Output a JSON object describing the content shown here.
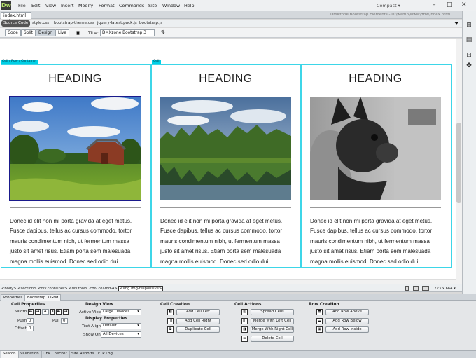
{
  "app": {
    "logo": "Dw",
    "menu": [
      "File",
      "Edit",
      "View",
      "Insert",
      "Modify",
      "Format",
      "Commands",
      "Site",
      "Window",
      "Help"
    ],
    "workspace": "Compact ▾"
  },
  "document": {
    "tab": "index.html",
    "path": "DMXzone Bootstrap Elements - D:\\wamp\\www\\dmf\\index.html"
  },
  "related_files": [
    "Source Code",
    "style.css",
    "bootstrap-theme.css",
    "jquery-latest.pack.js",
    "bootstrap.js"
  ],
  "view_buttons": [
    "Code",
    "Split",
    "Design",
    "Live"
  ],
  "title_label": "Title:",
  "title_value": "DMXzone Bootstrap 3",
  "canvas": {
    "badges": [
      "Cell / Row / Container",
      "Cell"
    ],
    "columns": [
      {
        "heading": "HEADING",
        "text": "Donec id elit non mi porta gravida at eget metus. Fusce dapibus, tellus ac cursus commodo, tortor mauris condimentum nibh, ut fermentum massa justo sit amet risus. Etiam porta sem malesuada magna mollis euismod. Donec sed odio dui.",
        "image": "barn-meadow"
      },
      {
        "heading": "HEADING",
        "text": "Donec id elit non mi porta gravida at eget metus. Fusce dapibus, tellus ac cursus commodo, tortor mauris condimentum nibh, ut fermentum massa justo sit amet risus. Etiam porta sem malesuada magna mollis euismod. Donec sed odio dui.",
        "image": "lake-forest"
      },
      {
        "heading": "HEADING",
        "text": "Donec id elit non mi porta gravida at eget metus. Fusce dapibus, tellus ac cursus commodo, tortor mauris condimentum nibh, ut fermentum massa justo sit amet risus. Etiam porta sem malesuada magna mollis euismod. Donec sed odio dui.",
        "image": "french-bulldog"
      }
    ]
  },
  "status": {
    "tags": [
      "<body>",
      "<section>",
      "<div.container>",
      "<div.row>",
      "<div.col-md-4>"
    ],
    "selected_tag": "<img.img-responsive>",
    "window_size": "1223 x 664 ▾"
  },
  "panel_tabs": [
    "Properties",
    "Bootstrap 3 Grid"
  ],
  "props": {
    "cell_properties": "Cell Properties",
    "width_label": "Width",
    "width_value": "4",
    "push_label": "Push",
    "push_value": "0",
    "pull_label": "Pull",
    "pull_value": "0",
    "offset_label": "Offset",
    "offset_value": "0",
    "design_view": "Design View",
    "active_view_label": "Active View",
    "active_view_value": "Large Devices",
    "display_properties": "Display Properties",
    "text_align_label": "Text Align",
    "text_align_value": "Default",
    "show_on_label": "Show On",
    "show_on_value": "All Devices",
    "cell_creation": "Cell Creation",
    "cell_creation_buttons": [
      "Add Cell Left",
      "Add Cell Right",
      "Duplicate Cell"
    ],
    "cell_actions": "Cell Actions",
    "cell_action_buttons": [
      "Spread Cells",
      "Merge With Left Cell",
      "Merge With Right Cell",
      "Delete Cell"
    ],
    "row_creation": "Row Creation",
    "row_creation_buttons": [
      "Add Row Above",
      "Add Row Below",
      "Add Row Inside"
    ]
  },
  "bottom_tabs": [
    "Search",
    "Validation",
    "Link Checker",
    "Site Reports",
    "FTP Log"
  ],
  "colors": {
    "cell_outline": "#3dd6e8",
    "badge": "#00d0e6",
    "selection": "#1a1a8c"
  }
}
